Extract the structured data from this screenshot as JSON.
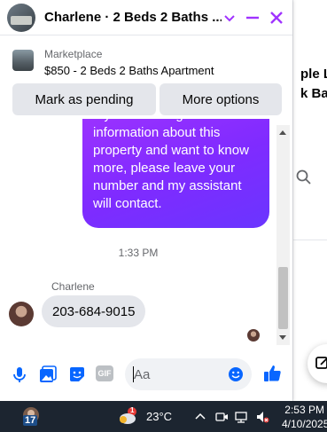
{
  "chat_window": {
    "title": "Charlene · 2 Beds 2 Baths ...",
    "marketplace_label": "Marketplace",
    "listing_title": "$850 - 2 Beds 2 Baths Apartment",
    "buttons": {
      "mark_pending": "Mark as pending",
      "more_options": "More options"
    },
    "accent_color": "#a033ff"
  },
  "messages": {
    "outgoing_text": "If you want to get more information about this property and want to know more, please leave your number and my assistant will contact.",
    "timestamp": "1:33 PM",
    "sender_name": "Charlene",
    "incoming_text": "203-684-9015"
  },
  "composer": {
    "placeholder": "Aa",
    "gif_label": "GIF"
  },
  "background_page": {
    "line1": "ple Lo",
    "line2": "k Bag!"
  },
  "taskbar": {
    "app_badge": "17",
    "weather_badge": "1",
    "temperature": "23°C",
    "time": "2:53 PM",
    "date": "4/10/2025"
  }
}
